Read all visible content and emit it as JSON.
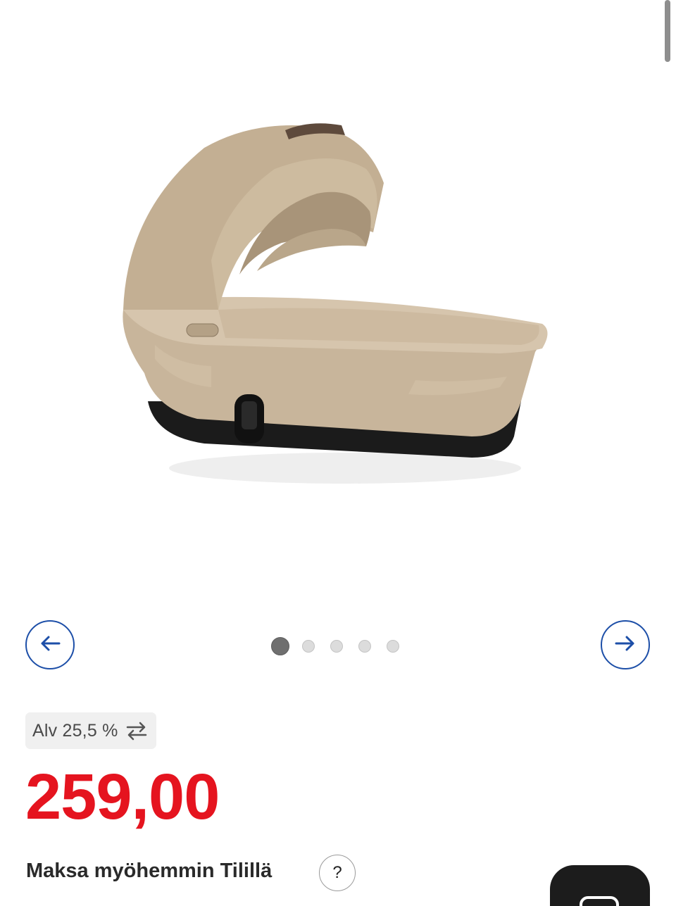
{
  "scrollbar": {
    "visible": true
  },
  "gallery": {
    "image_description_icon": "carrycot-product-image",
    "prev_icon": "arrow-left-icon",
    "next_icon": "arrow-right-icon",
    "dots_total": 5,
    "active_index": 0,
    "accent_color": "#1d4fa8"
  },
  "vat": {
    "label": "Alv 25,5 %",
    "icon": "swap-arrows-icon"
  },
  "price": {
    "value": "259,00",
    "color": "#e5141f"
  },
  "pay_later": {
    "label": "Maksa myöhemmin Tilillä",
    "help_label": "?"
  },
  "floating_action": {
    "icon": "chat-icon"
  }
}
